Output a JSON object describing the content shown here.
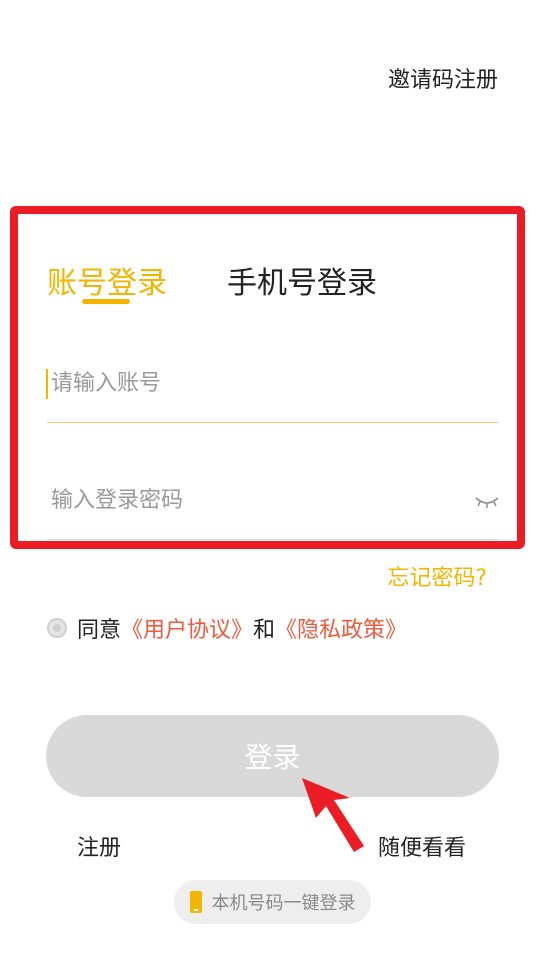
{
  "header": {
    "invite_register": "邀请码注册"
  },
  "tabs": [
    {
      "label": "账号登录",
      "active": true
    },
    {
      "label": "手机号登录",
      "active": false
    }
  ],
  "form": {
    "account_placeholder": "请输入账号",
    "password_placeholder": "输入登录密码",
    "forgot_password": "忘记密码?"
  },
  "agreement": {
    "agree_text": "同意",
    "user_agreement": "《用户协议》",
    "and_text": "和",
    "privacy_policy": "《隐私政策》"
  },
  "buttons": {
    "login": "登录",
    "register": "注册",
    "browse": "随便看看",
    "one_key_login": "本机号码一键登录"
  },
  "colors": {
    "accent": "#f2b500",
    "link": "#ef5a3c",
    "highlight": "#ec1c24",
    "button_disabled": "#d9d9d9"
  },
  "icons": [
    "eye-closed-icon",
    "phone-icon",
    "radio-icon",
    "arrow-pointer-icon"
  ]
}
